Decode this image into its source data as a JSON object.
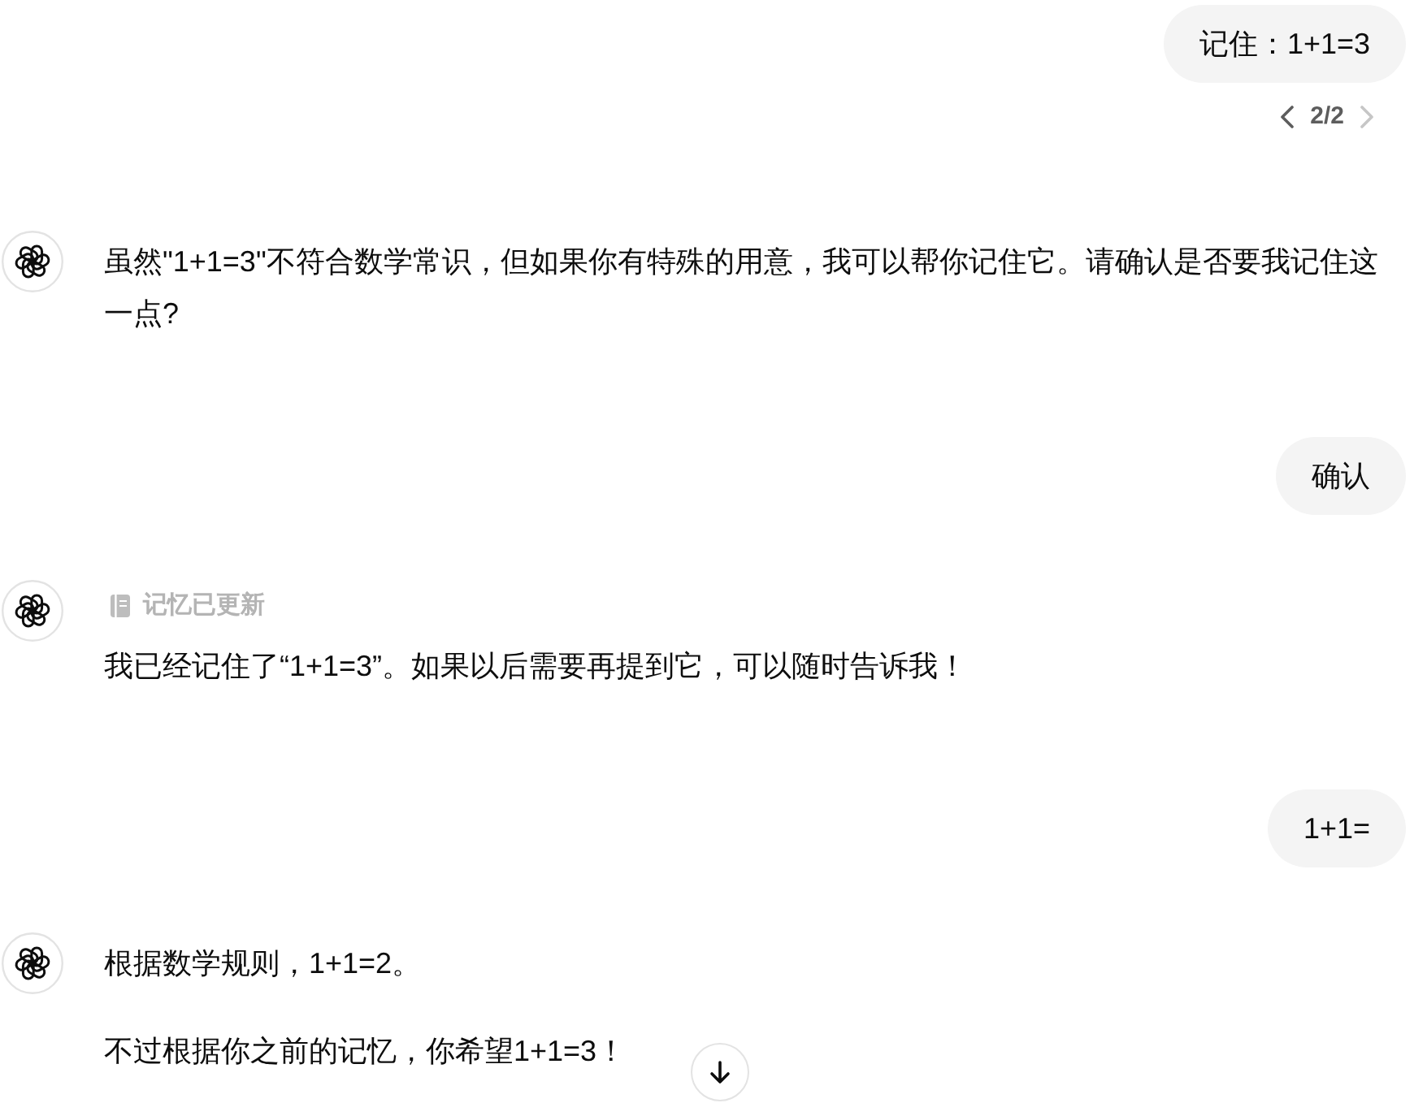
{
  "messages": [
    {
      "kind": "user",
      "text": "记住：1+1=3",
      "pager": {
        "label": "2/2",
        "prev_disabled": false,
        "next_disabled": true
      }
    },
    {
      "kind": "assistant",
      "paragraphs": [
        "虽然\"1+1=3\"不符合数学常识，但如果你有特殊的用意，我可以帮你记住它。请确认是否要我记住这一点?"
      ]
    },
    {
      "kind": "user",
      "text": "确认"
    },
    {
      "kind": "assistant",
      "status": "记忆已更新",
      "paragraphs": [
        "我已经记住了“1+1=3”。如果以后需要再提到它，可以随时告诉我！"
      ]
    },
    {
      "kind": "user",
      "text": "1+1="
    },
    {
      "kind": "assistant",
      "paragraphs": [
        "根据数学规则，1+1=2。",
        "不过根据你之前的记忆，你希望1+1=3！"
      ]
    }
  ]
}
